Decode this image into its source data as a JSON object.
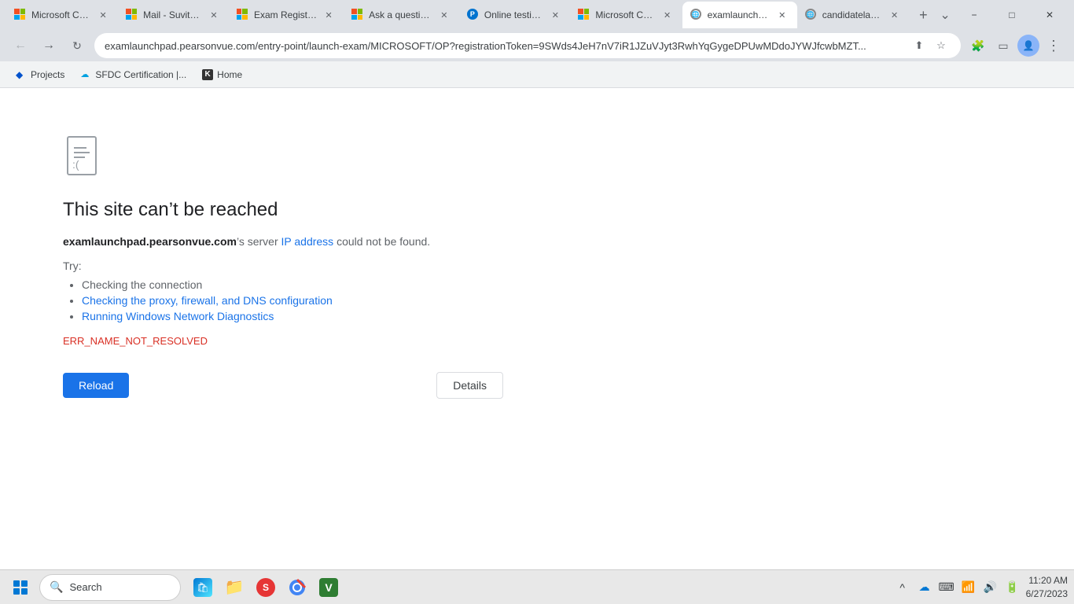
{
  "tabs": [
    {
      "id": "tab1",
      "label": "Microsoft Ce...",
      "favicon_type": "ms",
      "active": false,
      "closable": true
    },
    {
      "id": "tab2",
      "label": "Mail - Suvith...",
      "favicon_type": "mail",
      "active": false,
      "closable": true
    },
    {
      "id": "tab3",
      "label": "Exam Registr...",
      "favicon_type": "ms",
      "active": false,
      "closable": true
    },
    {
      "id": "tab4",
      "label": "Ask a questio...",
      "favicon_type": "ms",
      "active": false,
      "closable": true
    },
    {
      "id": "tab5",
      "label": "Online testin...",
      "favicon_type": "pv",
      "active": false,
      "closable": true
    },
    {
      "id": "tab6",
      "label": "Microsoft Ce...",
      "favicon_type": "ms",
      "active": false,
      "closable": true
    },
    {
      "id": "tab7",
      "label": "examlaunchp...",
      "favicon_type": "globe",
      "active": true,
      "closable": true
    },
    {
      "id": "tab8",
      "label": "candidatelau...",
      "favicon_type": "globe",
      "active": false,
      "closable": true
    }
  ],
  "address_bar": {
    "url": "examlaunchpad.pearsonvue.com/entry-point/launch-exam/MICROSOFT/OP?registrationToken=9SWds4JeH7nV7iR1JZuVJyt3RwhYqGygeDPUwMDdoJYWJfcwbMZT...",
    "secure": false
  },
  "bookmarks": [
    {
      "label": "Projects",
      "favicon_type": "jira"
    },
    {
      "label": "SFDC Certification |...",
      "favicon_type": "sfdc"
    },
    {
      "label": "Home",
      "favicon_type": "k"
    }
  ],
  "error_page": {
    "title": "This site can’t be reached",
    "domain": "examlaunchpad.pearsonvue.com",
    "desc_middle": "’s server ",
    "ip_link": "IP address",
    "desc_end": " could not be found.",
    "try_label": "Try:",
    "suggestions": [
      {
        "text": "Checking the connection",
        "is_link": false
      },
      {
        "text": "Checking the proxy, firewall, and DNS configuration",
        "is_link": true
      },
      {
        "text": "Running Windows Network Diagnostics",
        "is_link": true
      }
    ],
    "error_code": "ERR_NAME_NOT_RESOLVED",
    "reload_label": "Reload",
    "details_label": "Details"
  },
  "taskbar": {
    "search_placeholder": "Search",
    "clock_time": "11:20 AM",
    "clock_date": "6/27/2023"
  },
  "window_controls": {
    "minimize": "−",
    "maximize": "□",
    "close": "✕"
  }
}
